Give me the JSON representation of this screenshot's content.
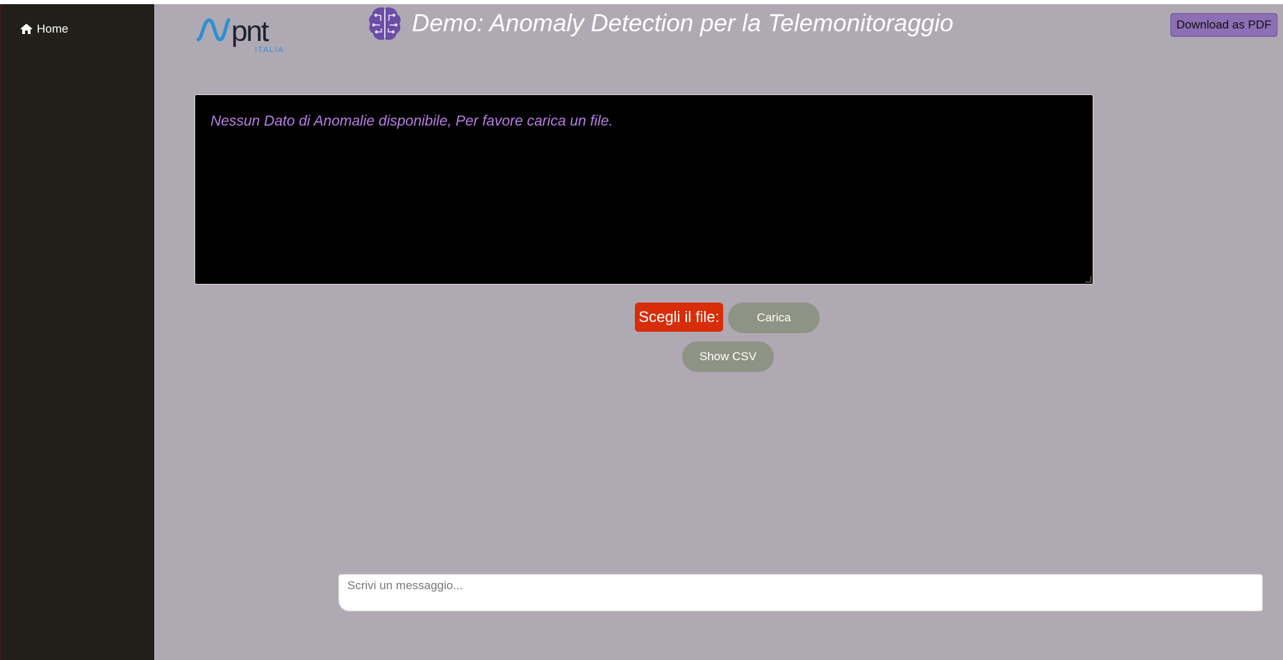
{
  "sidebar": {
    "home_label": "Home",
    "home_icon": "home-icon"
  },
  "header": {
    "logo_main": "pnt",
    "logo_sub": "ITALIA",
    "title": "Demo: Anomaly Detection per la Telemonitoraggio",
    "title_icon": "brain-circuit-icon",
    "download_label": "Download as PDF"
  },
  "output": {
    "message": "Nessun Dato di Anomalie disponibile, Per favore carica un file."
  },
  "upload": {
    "choose_file_label": "Scegli il file:",
    "upload_label": "Carica",
    "show_csv_label": "Show CSV"
  },
  "chat": {
    "placeholder": "Scrivi un messaggio..."
  },
  "colors": {
    "background": "#afa9b3",
    "sidebar": "#201f1a",
    "accent_purple": "#8d6fb5",
    "choose_file_red": "#d92c08",
    "button_gray": "#8f9385",
    "output_text": "#b87ee6",
    "logo_blue": "#2e8fd0",
    "logo_dark": "#1c2230"
  }
}
